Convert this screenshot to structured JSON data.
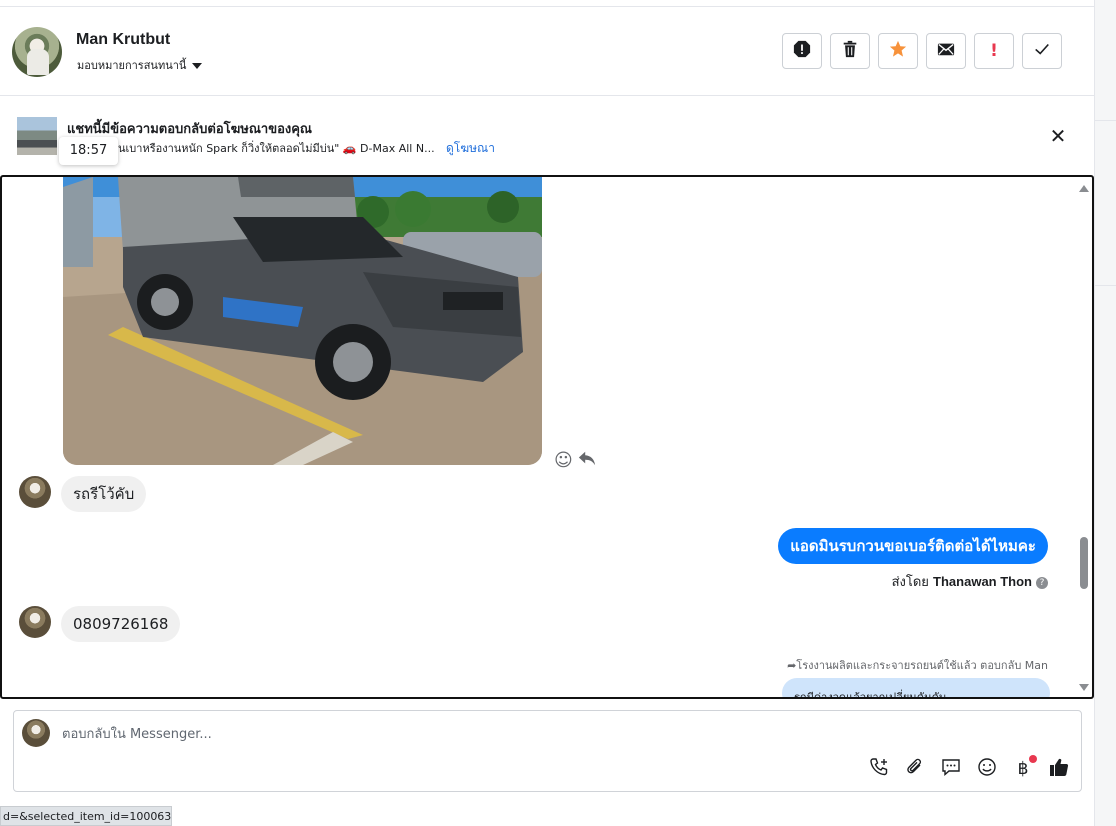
{
  "header": {
    "user_name": "Man Krutbut",
    "assign_label": "มอบหมายการสนทนานี้",
    "actions": [
      {
        "name": "report-icon",
        "glyph": "!"
      },
      {
        "name": "trash-icon",
        "glyph": ""
      },
      {
        "name": "star-icon",
        "glyph": "★"
      },
      {
        "name": "mail-icon",
        "glyph": ""
      },
      {
        "name": "important-icon",
        "glyph": "!"
      },
      {
        "name": "check-icon",
        "glyph": "✓"
      }
    ]
  },
  "ad_banner": {
    "title": "แชทนี้มีข้อความตอบกลับต่อโฆษณาของคุณ",
    "description": "นเบาหรืองานหนัก Spark ก็วิ่งให้ตลอดไม่มีบ่น\" 🚗 D-Max All N...",
    "link": "ดูโฆษณา",
    "tooltip_time": "18:57"
  },
  "messages": {
    "incoming_1": "รถรีโว้คับ",
    "outgoing_1": "แอดมินรบกวนขอเบอร์ติดต่อได้ไหมคะ",
    "sent_by_prefix": "ส่งโดย",
    "sent_by_name": "Thanawan Thon",
    "incoming_2": "0809726168",
    "reply_note": "โรงงานผลิตและกระจายรถยนต์ใช้แล้ว ตอบกลับ Man",
    "reply_preview": "รถมีค่างวดแล้วยากเปลี่ยนคันคับ"
  },
  "composer": {
    "placeholder": "ตอบกลับใน Messenger..."
  },
  "status_bar": {
    "url_fragment": "d=&selected_item_id=100063..."
  },
  "colors": {
    "accent_blue": "#0a7cff",
    "link_blue": "#216fdb",
    "star_orange": "#f7923b",
    "danger_red": "#e8384f"
  }
}
